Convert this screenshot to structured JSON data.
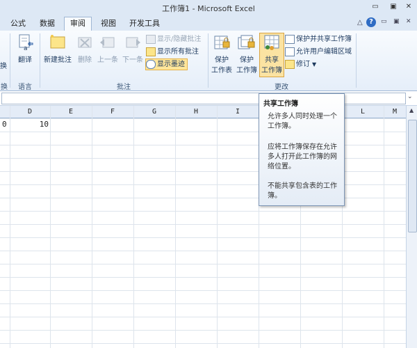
{
  "window": {
    "title": "工作簿1 - Microsoft Excel",
    "minimize_glyph": "▭",
    "restore_glyph": "▣",
    "close_glyph": "✕"
  },
  "tabs": [
    {
      "label": "公式",
      "active": false
    },
    {
      "label": "数据",
      "active": false
    },
    {
      "label": "审阅",
      "active": true
    },
    {
      "label": "视图",
      "active": false
    },
    {
      "label": "开发工具",
      "active": false
    }
  ],
  "ribbon_right_glyphs": {
    "collapse": "△",
    "help": "?",
    "min": "▭",
    "restore": "▣",
    "close": "✕"
  },
  "ribbon": {
    "left_partial": {
      "label": "换",
      "group": "换"
    },
    "language": {
      "translate_label": "翻译",
      "group_label": "语言"
    },
    "comments": {
      "new_comment": "新建批注",
      "delete": "删除",
      "previous": "上一条",
      "next": "下一条",
      "show_hide": "显示/隐藏批注",
      "show_all": "显示所有批注",
      "show_ink": "显示墨迹",
      "group_label": "批注"
    },
    "changes": {
      "protect_sheet_line1": "保护",
      "protect_sheet_line2": "工作表",
      "protect_workbook_line1": "保护",
      "protect_workbook_line2": "工作簿",
      "share_workbook_line1": "共享",
      "share_workbook_line2": "工作簿",
      "protect_share": "保护并共享工作簿",
      "allow_edit_ranges": "允许用户编辑区域",
      "track_changes": "修订",
      "group_label": "更改"
    }
  },
  "grid": {
    "columns": [
      "D",
      "E",
      "F",
      "G",
      "H",
      "I",
      "L",
      "M"
    ],
    "cells": {
      "c_partial": "0",
      "d1": "10"
    }
  },
  "tooltip": {
    "title": "共享工作簿",
    "para1": "允许多人同时处理一个工作簿。",
    "para2": "应将工作簿保存在允许多人打开此工作簿的网络位置。",
    "para3": "不能共享包含表的工作簿。"
  },
  "colors": {
    "accent": "#1e3a5f",
    "highlight": "#ffe69a",
    "ribbon_bg": "#e5eef9"
  }
}
